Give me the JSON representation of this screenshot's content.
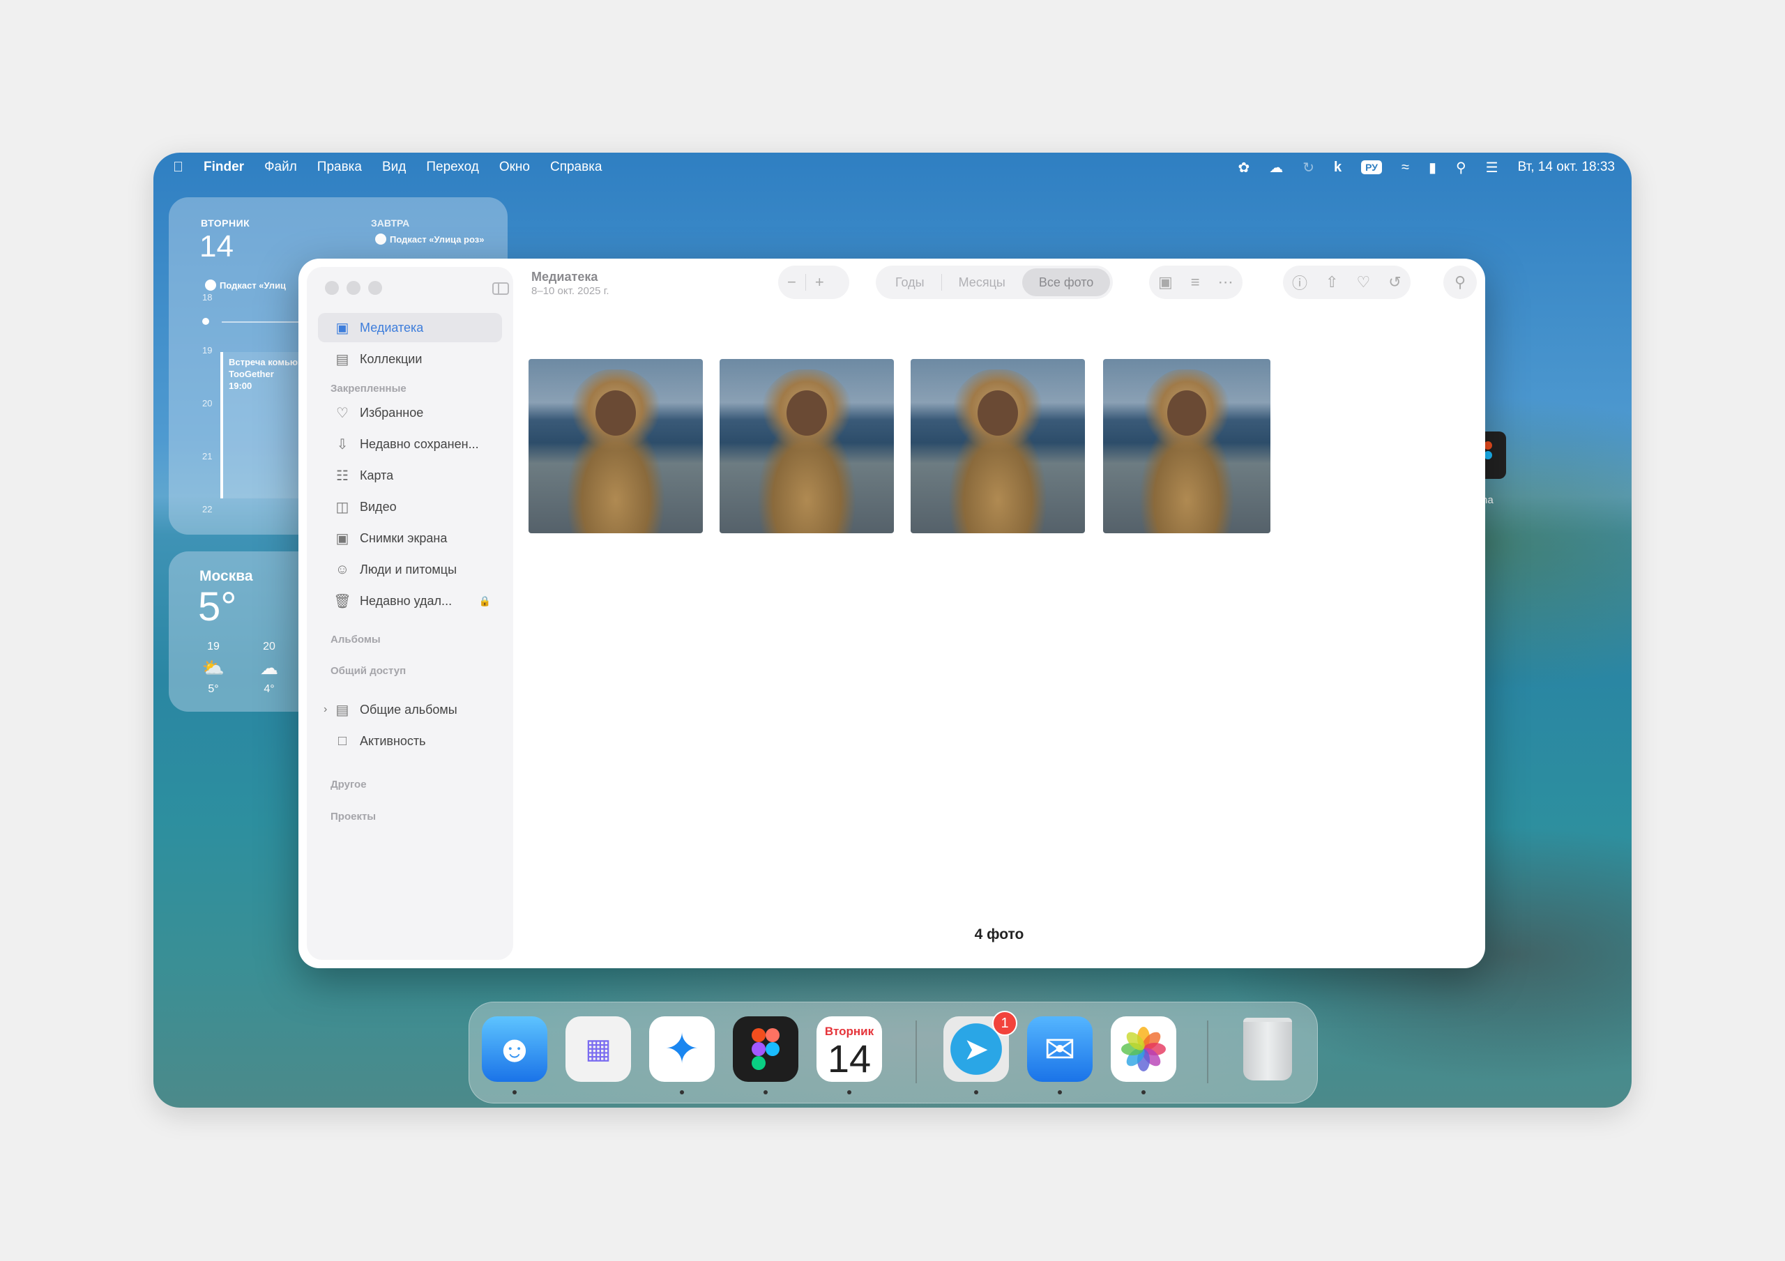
{
  "menubar": {
    "apple_icon": "apple-logo",
    "app_name": "Finder",
    "menus": [
      "Файл",
      "Правка",
      "Вид",
      "Переход",
      "Окно",
      "Справка"
    ],
    "input_language": "РУ",
    "datetime": "Вт, 14 окт. 18:33"
  },
  "calendar_widget": {
    "day_label": "ВТОРНИК",
    "day_number": "14",
    "tomorrow_label": "ЗАВТРА",
    "today_event": "Подкаст «Улиц",
    "tomorrow_event": "Подкаст «Улица роз»",
    "hours": [
      "18",
      "19",
      "20",
      "21",
      "22"
    ],
    "event_title_line1": "Встреча комьюн",
    "event_title_line2": "TooGether",
    "event_time": "19:00"
  },
  "weather_widget": {
    "city": "Москва",
    "temperature": "5°",
    "forecast": [
      {
        "hour": "19",
        "icon": "cloud-sun-rain-icon",
        "temp": "5°"
      },
      {
        "hour": "20",
        "icon": "cloud-icon",
        "temp": "4°"
      }
    ]
  },
  "peek_label": "na",
  "photos_window": {
    "title": "Медиатека",
    "subtitle": "8–10 окт. 2025 г.",
    "segments": [
      "Годы",
      "Месяцы",
      "Все фото"
    ],
    "active_segment": "Все фото",
    "sidebar": {
      "items_top": [
        {
          "label": "Медиатека",
          "icon": "photo-library-icon",
          "active": true
        },
        {
          "label": "Коллекции",
          "icon": "collections-icon",
          "active": false
        }
      ],
      "pinned_header": "Закрепленные",
      "pinned": [
        {
          "label": "Избранное",
          "icon": "heart-icon"
        },
        {
          "label": "Недавно сохранен...",
          "icon": "recently-saved-icon"
        },
        {
          "label": "Карта",
          "icon": "map-icon"
        },
        {
          "label": "Видео",
          "icon": "video-icon"
        },
        {
          "label": "Снимки экрана",
          "icon": "screenshot-icon"
        },
        {
          "label": "Люди и питомцы",
          "icon": "person-icon"
        },
        {
          "label": "Недавно удал...",
          "icon": "trash-icon"
        }
      ],
      "albums_header": "Альбомы",
      "shared_header": "Общий доступ",
      "shared": [
        {
          "label": "Общие альбомы",
          "icon": "shared-albums-icon"
        },
        {
          "label": "Активность",
          "icon": "activity-icon"
        }
      ],
      "other_header": "Другое",
      "projects_header": "Проекты"
    },
    "photo_count": "4 фото"
  },
  "dock": {
    "apps": [
      "Finder",
      "Launchpad",
      "Safari",
      "Figma",
      "Calendar",
      "Telegram",
      "Mail",
      "Photos",
      "Trash"
    ],
    "calendar_day_name": "Вторник",
    "calendar_day_number": "14",
    "telegram_badge": "1"
  }
}
